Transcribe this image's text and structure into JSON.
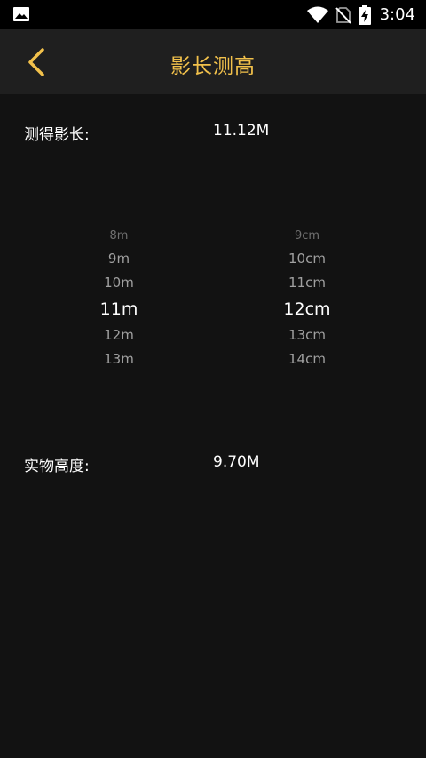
{
  "status_bar": {
    "time": "3:04",
    "icons": [
      "gallery-icon",
      "wifi-icon",
      "no-sim-icon",
      "battery-charging-icon"
    ]
  },
  "app_bar": {
    "title": "影长测高",
    "back_icon": "chevron-left-icon"
  },
  "shadow": {
    "label": "测得影长:",
    "value": "11.12M"
  },
  "pickers": {
    "meters": [
      "8m",
      "9m",
      "10m",
      "11m",
      "12m",
      "13m"
    ],
    "meters_selected": "11m",
    "centimeters": [
      "9cm",
      "10cm",
      "11cm",
      "12cm",
      "13cm",
      "14cm"
    ],
    "centimeters_selected": "12cm"
  },
  "result": {
    "label": "实物高度:",
    "value": "9.70M"
  },
  "colors": {
    "accent": "#f2c14b",
    "background": "#121212",
    "app_bar": "#1f1f1f"
  }
}
